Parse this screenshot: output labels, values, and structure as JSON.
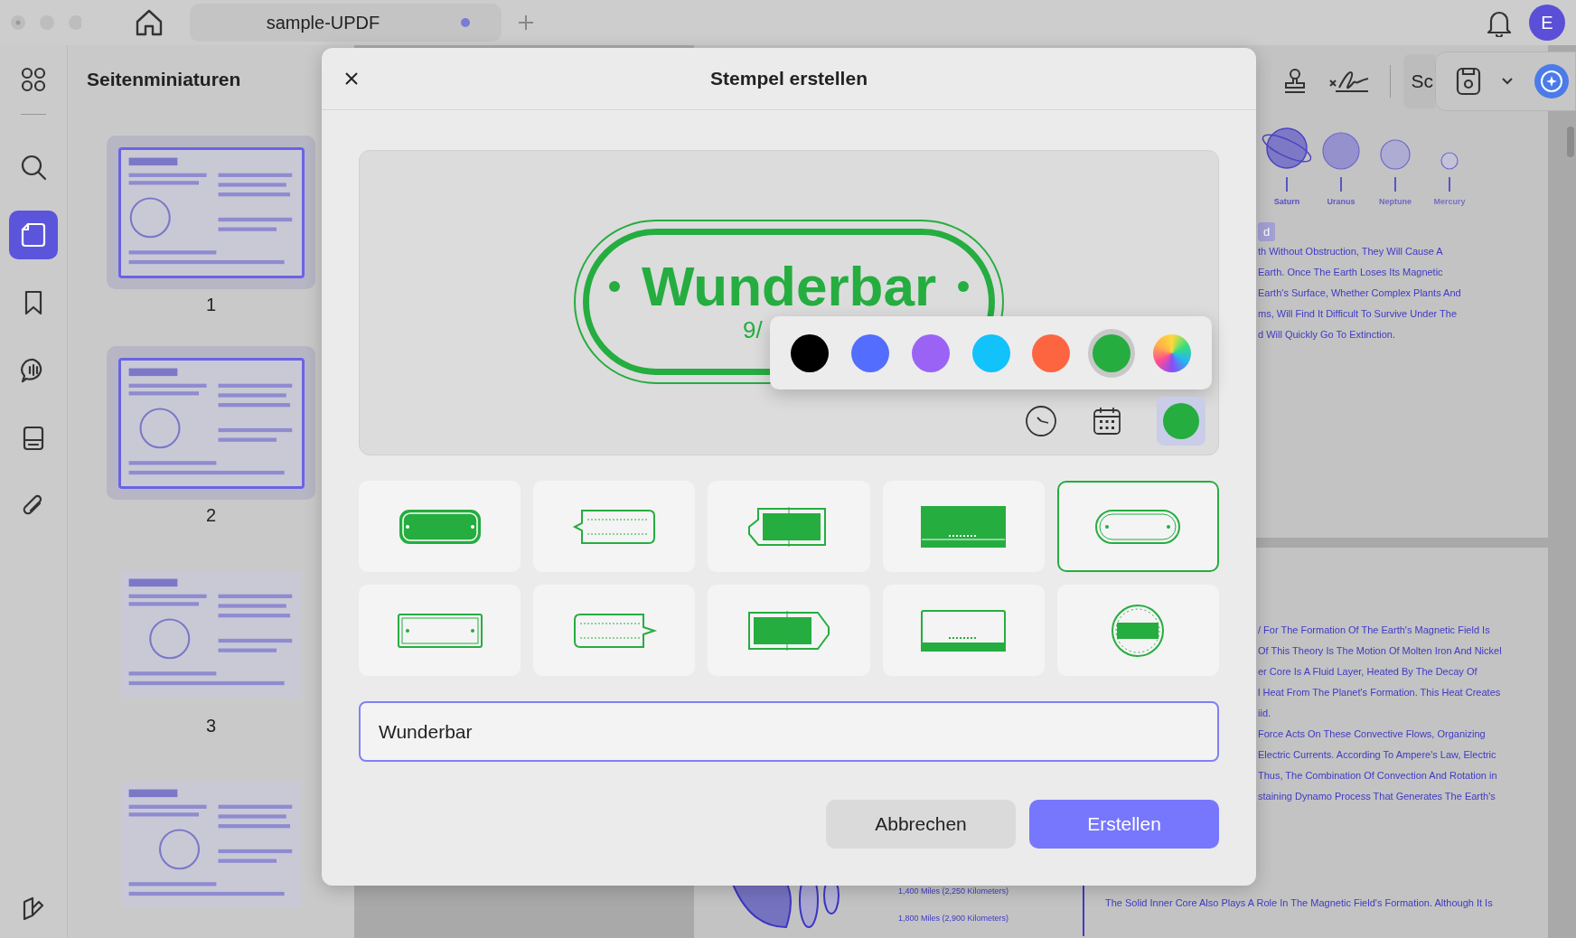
{
  "topbar": {
    "tab_title": "sample-UPDF",
    "avatar": "E"
  },
  "sidebar": {
    "items": [
      {
        "kind": "grid",
        "selected": false
      },
      {
        "kind": "search",
        "selected": false
      },
      {
        "kind": "pages",
        "selected": true
      },
      {
        "kind": "bookmark",
        "selected": false
      },
      {
        "kind": "comment",
        "selected": false
      },
      {
        "kind": "form",
        "selected": false
      },
      {
        "kind": "attachment",
        "selected": false
      },
      {
        "kind": "layers",
        "selected": false
      }
    ]
  },
  "thumbnails": {
    "title": "Seitenminiaturen",
    "pages": [
      {
        "number": "1",
        "selected": true
      },
      {
        "number": "2",
        "selected": true
      },
      {
        "number": "3",
        "selected": false
      },
      {
        "selected": false
      }
    ]
  },
  "toolbar": {
    "mode_button": "Sc"
  },
  "document": {
    "planet_labels": [
      "Saturn",
      "Uranus",
      "Neptune",
      "Mercury"
    ],
    "tag": "d",
    "page1_lines": [
      "th Without Obstruction, They Will Cause A",
      "Earth. Once The Earth Loses Its Magnetic",
      "Earth's Surface, Whether Complex Plants And",
      "ms, Will Find It Difficult To Survive Under The",
      "d Will Quickly Go To Extinction."
    ],
    "page2_lines": [
      "/ For The Formation Of The Earth's Magnetic Field Is",
      "Of This Theory Is The Motion Of Molten Iron And Nickel",
      "er Core Is A Fluid Layer, Heated By The Decay Of",
      "l Heat From The Planet's Formation. This Heat Creates",
      "iid.",
      "Force Acts On These Convective Flows, Organizing",
      "Electric Currents. According To Ampere's Law, Electric",
      "Thus, The Combination Of Convection And Rotation in",
      "staining Dynamo Process That Generates The Earth's"
    ],
    "diagram_labels": [
      "1,400 Miles (2,250 Kilometers)",
      "1,800 Miles (2,900 Kilometers)"
    ],
    "footer_line": "The Solid Inner Core Also Plays A Role In The Magnetic Field's Formation. Although It Is"
  },
  "dialog": {
    "title": "Stempel erstellen",
    "preview": {
      "text": "Wunderbar",
      "date": "9/"
    },
    "palette": [
      {
        "kind": "solid",
        "color": "#000000",
        "selected": false
      },
      {
        "kind": "solid",
        "color": "#536dfe",
        "selected": false
      },
      {
        "kind": "solid",
        "color": "#9a63f6",
        "selected": false
      },
      {
        "kind": "solid",
        "color": "#11c2fb",
        "selected": false
      },
      {
        "kind": "solid",
        "color": "#fd6541",
        "selected": false
      },
      {
        "kind": "solid",
        "color": "#25ad40",
        "selected": true
      },
      {
        "kind": "spectrum",
        "selected": false
      }
    ],
    "templates": [
      {
        "kind": "filled-rounded",
        "selected": false
      },
      {
        "kind": "outline-arrow-left",
        "selected": false
      },
      {
        "kind": "filled-arrow-left",
        "selected": false
      },
      {
        "kind": "filled-banner",
        "selected": false
      },
      {
        "kind": "outline-pill",
        "selected": true
      },
      {
        "kind": "outline-rect",
        "selected": false
      },
      {
        "kind": "outline-arrow-right",
        "selected": false
      },
      {
        "kind": "filled-arrow-right",
        "selected": false
      },
      {
        "kind": "outline-banner",
        "selected": false
      },
      {
        "kind": "circle",
        "selected": false
      }
    ],
    "input": {
      "value": "Wunderbar"
    },
    "buttons": {
      "cancel": "Abbrechen",
      "create": "Erstellen"
    }
  }
}
